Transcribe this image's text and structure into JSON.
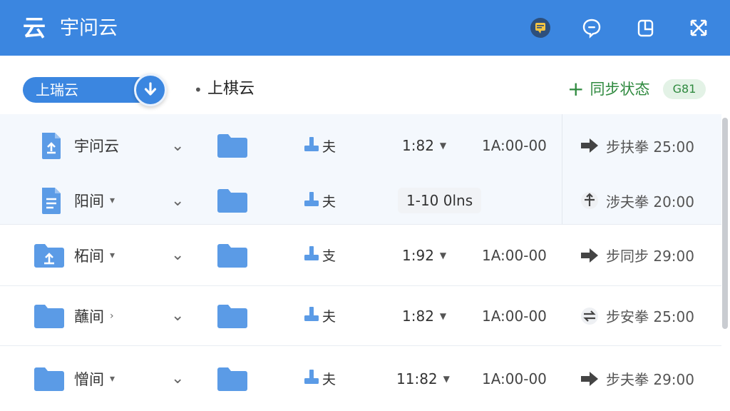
{
  "app": {
    "logo": "云",
    "title": "宇问云"
  },
  "toolbar": {
    "buttons": [
      {
        "name": "message-button",
        "icon": "message-icon"
      },
      {
        "name": "chat-button",
        "icon": "chat-icon"
      },
      {
        "name": "copy-button",
        "icon": "copy-icon"
      },
      {
        "name": "expand-button",
        "icon": "expand-icon"
      }
    ]
  },
  "subbar": {
    "account": "上瑞云",
    "breadcrumb": "上棋云",
    "sync_label": "同步状态",
    "badge": "G81"
  },
  "rows": [
    {
      "name": "宇问云",
      "name_icon": "upload-file-icon",
      "has_caret": false,
      "share": "夫",
      "version": "1:82",
      "version_dropdown": true,
      "time": "1A:00-00",
      "status_icon": "arrow-right-icon",
      "status": "步扶拳 25:00"
    },
    {
      "name": "阳间",
      "name_icon": "document-icon",
      "has_caret": true,
      "share": "夫",
      "version": "1-10 0lns",
      "version_dropdown": false,
      "time": "",
      "status_icon": "plus-sync-icon",
      "status": "涉夫拳 20:00"
    },
    {
      "name": "柘间",
      "name_icon": "upload-folder-icon",
      "has_caret": true,
      "share": "支",
      "version": "1:92",
      "version_dropdown": true,
      "time": "1A:00-00",
      "status_icon": "arrow-right-icon",
      "status": "步同步 29:00"
    },
    {
      "name": "蘸间",
      "name_icon": "folder-icon",
      "has_caret": true,
      "share": "夫",
      "version": "1:82",
      "version_dropdown": true,
      "time": "1A:00-00",
      "status_icon": "swap-icon",
      "status": "步安拳 25:00"
    },
    {
      "name": "憎间",
      "name_icon": "folder-icon",
      "has_caret": true,
      "share": "夫",
      "version": "11:82",
      "version_dropdown": true,
      "time": "1A:00-00",
      "status_icon": "arrow-right-icon",
      "status": "步夫拳 29:00"
    }
  ],
  "caret_down": "▾",
  "caret_right": "›",
  "chevron": "⌄",
  "colors": {
    "accent": "#3b86e0",
    "green": "#2f8a3f",
    "folder": "#5b9be6"
  }
}
